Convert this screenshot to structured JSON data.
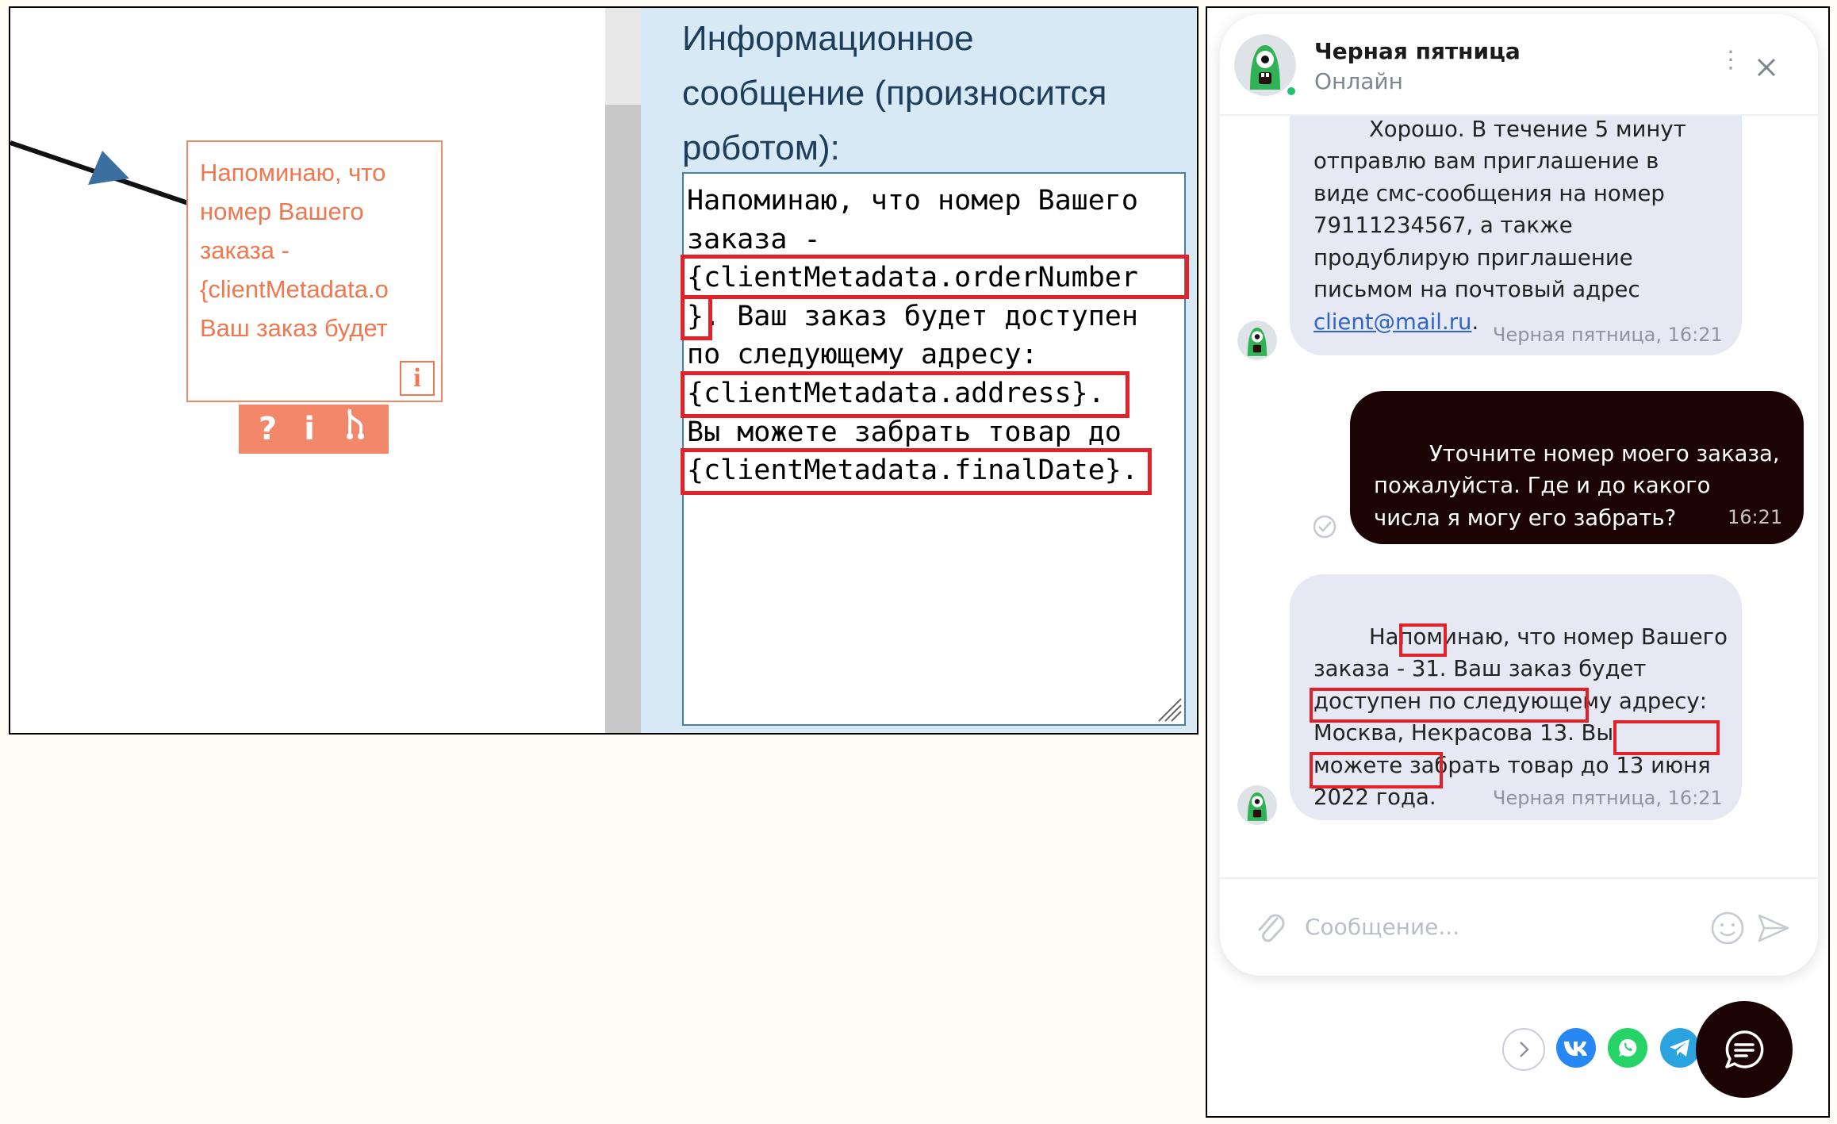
{
  "node": {
    "text": "Напоминаю, что\nномер Вашего\nзаказа -\n{clientMetadata.o\nВаш заказ будет",
    "info_icon": "i",
    "toolbar": [
      "?",
      "i",
      "branch"
    ]
  },
  "properties": {
    "title": "Информационное\nсообщение (произносится\nроботом):",
    "message": "Напоминаю, что номер Вашего\nзаказа -\n{clientMetadata.orderNumber\n}. Ваш заказ будет доступен\nпо следующему адресу:\n{clientMetadata.address}.\nВы можете забрать товар до\n{clientMetadata.finalDate}."
  },
  "chat": {
    "title": "Черная пятница",
    "status": "Онлайн",
    "messages": [
      {
        "from": "bot",
        "text_before": "Хорошо. В течение 5 минут\nотправлю вам приглашение в\nвиде смс-сообщения на номер\n79111234567, а также\nпродублирую приглашение\nписьмом на почтовый адрес\n",
        "link": "client@mail.ru",
        "text_after": ".",
        "meta": "Черная пятница, 16:21"
      },
      {
        "from": "user",
        "text": "Уточните номер моего заказа,\nпожалуйста. Где и до какого\nчисла я могу его забрать?",
        "time": "16:21"
      },
      {
        "from": "bot",
        "text": "Напоминаю, что номер Вашего\nзаказа - 31. Ваш заказ будет\nдоступен по следующему адресу:\nМосква, Некрасова 13. Вы\nможете забрать товар до 13 июня\n2022 года.",
        "meta": "Черная пятница, 16:21"
      }
    ],
    "input_placeholder": "Сообщение..."
  },
  "colors": {
    "accent_orange": "#f07850",
    "highlight_red": "#e32129",
    "bot_bubble": "#e6e8f3",
    "user_bubble": "#1c0404",
    "panel_blue": "#d7e9f5"
  },
  "icons": [
    "info-icon",
    "question-icon",
    "branch-icon",
    "resize-grip-icon",
    "bot-avatar-icon",
    "more-icon",
    "close-icon",
    "read-check-icon",
    "attach-icon",
    "emoji-icon",
    "send-icon",
    "chevron-right-icon",
    "vk-icon",
    "whatsapp-icon",
    "telegram-icon",
    "chat-icon"
  ]
}
